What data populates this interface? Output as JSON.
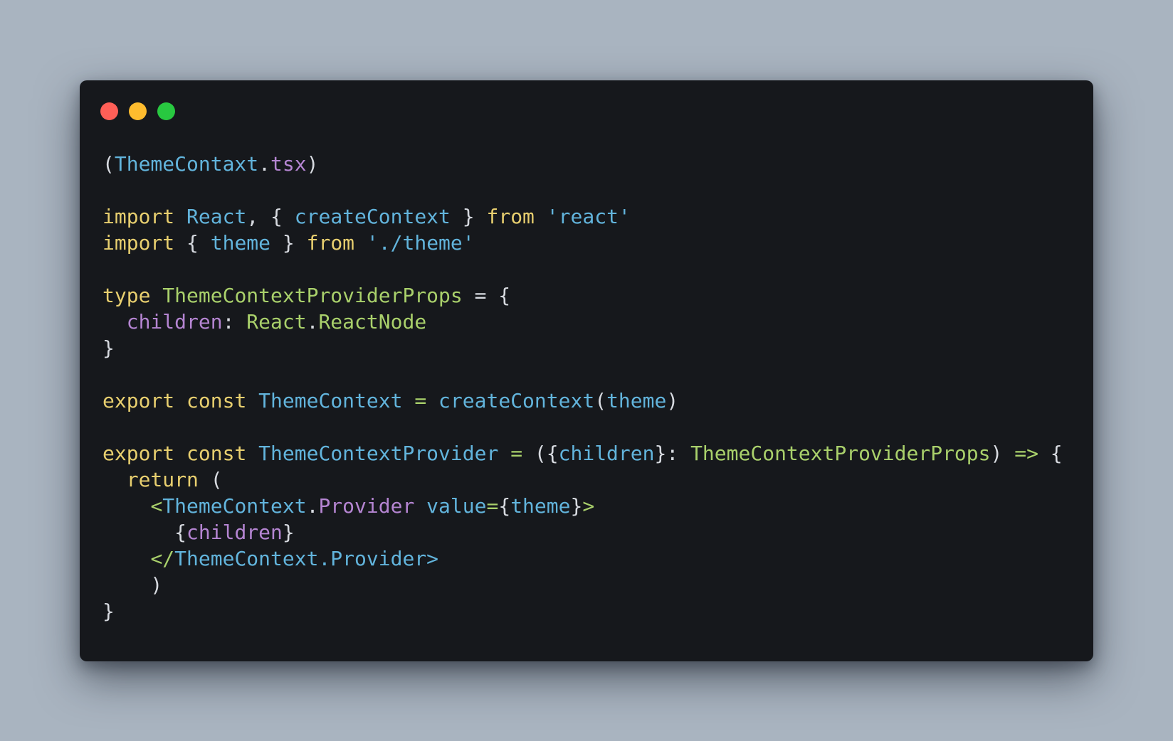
{
  "window": {
    "controls": {
      "close_color": "#ff5f57",
      "minimize_color": "#febc2e",
      "maximize_color": "#28c840"
    }
  },
  "code": {
    "filename_prefix": "(",
    "filename_name": "ThemeContaxt",
    "filename_dot": ".",
    "filename_ext": "tsx",
    "filename_suffix": ")",
    "lines": {
      "l1": {
        "t1": "import",
        "t2": " ",
        "t3": "React",
        "t4": ", { ",
        "t5": "createContext",
        "t6": " } ",
        "t7": "from",
        "t8": " ",
        "t9": "'react'"
      },
      "l2": {
        "t1": "import",
        "t2": " { ",
        "t3": "theme",
        "t4": " } ",
        "t5": "from",
        "t6": " ",
        "t7": "'./theme'"
      },
      "l3": {
        "t1": "type",
        "t2": " ",
        "t3": "ThemeContextProviderProps",
        "t4": " = {"
      },
      "l4": {
        "t1": "  ",
        "t2": "children",
        "t3": ": ",
        "t4": "React",
        "t5": ".",
        "t6": "ReactNode"
      },
      "l5": {
        "t1": "}"
      },
      "l6": {
        "t1": "export",
        "t2": " ",
        "t3": "const",
        "t4": " ",
        "t5": "ThemeContext",
        "t6": " ",
        "t7": "=",
        "t8": " ",
        "t9": "createContext",
        "t10": "(",
        "t11": "theme",
        "t12": ")"
      },
      "l7": {
        "t1": "export",
        "t2": " ",
        "t3": "const",
        "t4": " ",
        "t5": "ThemeContextProvider",
        "t6": " ",
        "t7": "=",
        "t8": " ({",
        "t9": "children",
        "t10": "}: ",
        "t11": "ThemeContextProviderProps",
        "t12": ") ",
        "t13": "=>",
        "t14": " {"
      },
      "l8": {
        "t1": "  ",
        "t2": "return",
        "t3": " ("
      },
      "l9": {
        "t1": "    ",
        "t2": "<",
        "t3": "ThemeContext",
        "t4": ".",
        "t5": "Provider",
        "t6": " ",
        "t7": "value",
        "t8": "=",
        "t9": "{",
        "t10": "theme",
        "t11": "}",
        "t12": ">"
      },
      "l10": {
        "t1": "      {",
        "t2": "children",
        "t3": "}"
      },
      "l11": {
        "t1": "    ",
        "t2": "</",
        "t3": "ThemeContext.Provider",
        "t4": ">"
      },
      "l12": {
        "t1": "    )"
      },
      "l13": {
        "t1": "}"
      }
    }
  }
}
